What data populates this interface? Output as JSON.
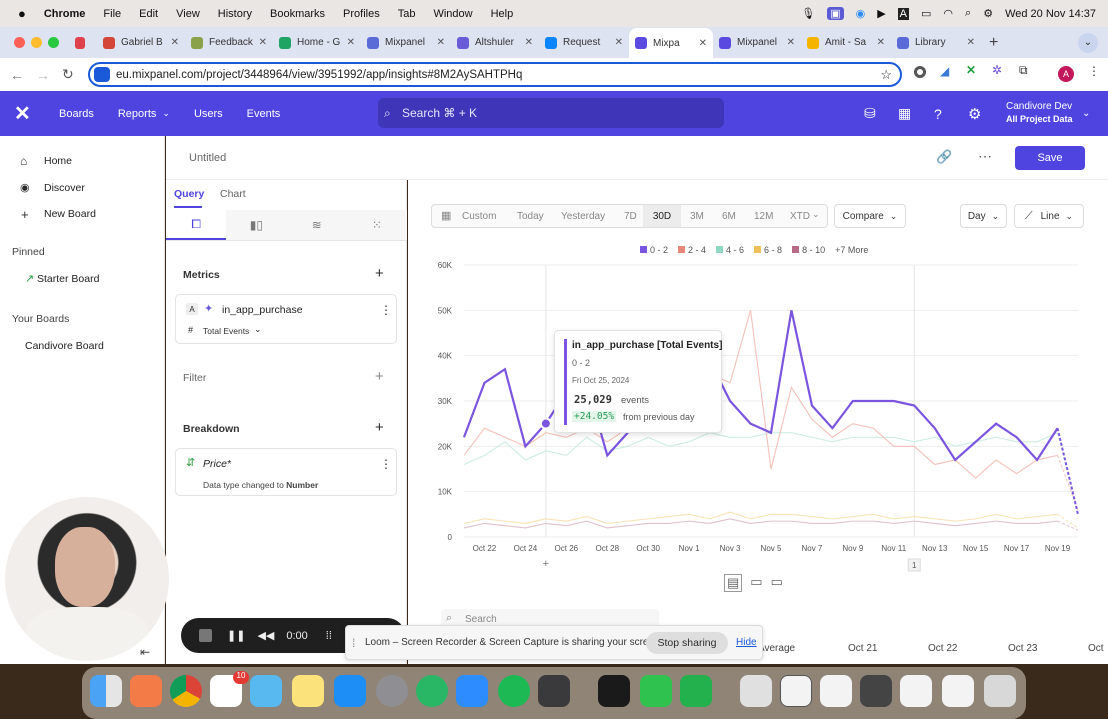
{
  "menubar": {
    "apple": "",
    "app": "Chrome",
    "menus": [
      "File",
      "Edit",
      "View",
      "History",
      "Bookmarks",
      "Profiles",
      "Tab",
      "Window",
      "Help"
    ],
    "datetime": "Wed 20 Nov  14:37"
  },
  "tabs": [
    {
      "label": "",
      "color": "#e0424b"
    },
    {
      "label": "Gabriel B",
      "color": "#d44638"
    },
    {
      "label": "Feedback",
      "color": "#8aa34a"
    },
    {
      "label": "Home - G",
      "color": "#1fa463"
    },
    {
      "label": "Mixpanel",
      "color": "#5a6bd8"
    },
    {
      "label": "Altshuler",
      "color": "#6a5cd6"
    },
    {
      "label": "Request",
      "color": "#0a84ff"
    },
    {
      "label": "Mixpa",
      "color": "#5a4ae0",
      "active": true
    },
    {
      "label": "Mixpanel",
      "color": "#5a4ae0"
    },
    {
      "label": "Amit - Sa",
      "color": "#f4b400"
    },
    {
      "label": "Library",
      "color": "#5a6bd8"
    }
  ],
  "address": {
    "url": "eu.mixpanel.com/project/3448964/view/3951992/app/insights#8M2AySAHTPHq"
  },
  "header": {
    "nav": [
      "Boards",
      "Reports",
      "Users",
      "Events"
    ],
    "search_placeholder": "Search  ⌘ + K",
    "org_name": "Candivore Dev",
    "org_sub": "All Project Data"
  },
  "sidebar": {
    "home": "Home",
    "discover": "Discover",
    "new_board": "New Board",
    "pinned": "Pinned",
    "starter_board": "Starter Board",
    "your_boards": "Your Boards",
    "candivore_board": "Candivore Board"
  },
  "report": {
    "title": "Untitled",
    "save": "Save"
  },
  "query": {
    "tab_query": "Query",
    "tab_chart": "Chart",
    "metrics": "Metrics",
    "metric_letter": "A",
    "metric_name": "in_app_purchase",
    "metric_measure": "Total Events",
    "filter": "Filter",
    "breakdown": "Breakdown",
    "breakdown_prop": "Price*",
    "breakdown_note_pre": "Data type changed to ",
    "breakdown_note_bold": "Number"
  },
  "toolbar": {
    "ranges": [
      "Custom",
      "Today",
      "Yesterday",
      "7D",
      "30D",
      "3M",
      "6M",
      "12M",
      "XTD"
    ],
    "active_range": "30D",
    "compare": "Compare",
    "granularity": "Day",
    "chart_type": "Line"
  },
  "legend": [
    {
      "label": "0 - 2",
      "color": "#7b55e0"
    },
    {
      "label": "2 - 4",
      "color": "#e8877a"
    },
    {
      "label": "4 - 6",
      "color": "#8fd9c4"
    },
    {
      "label": "6 - 8",
      "color": "#efbf5a"
    },
    {
      "label": "8 - 10",
      "color": "#b56a86"
    }
  ],
  "legend_more": "+7 More",
  "tooltip": {
    "title": "in_app_purchase [Total Events]",
    "series": "0 - 2",
    "date": "Fri Oct 25, 2024",
    "value": "25,029",
    "unit": "events",
    "change": "+24.05%",
    "change_label": "from previous day"
  },
  "chart_data": {
    "type": "line",
    "x": [
      "Oct 21",
      "Oct 22",
      "Oct 23",
      "Oct 24",
      "Oct 25",
      "Oct 26",
      "Oct 27",
      "Oct 28",
      "Oct 29",
      "Oct 30",
      "Oct 31",
      "Nov 1",
      "Nov 2",
      "Nov 3",
      "Nov 4",
      "Nov 5",
      "Nov 6",
      "Nov 7",
      "Nov 8",
      "Nov 9",
      "Nov 10",
      "Nov 11",
      "Nov 12",
      "Nov 13",
      "Nov 14",
      "Nov 15",
      "Nov 16",
      "Nov 17",
      "Nov 18",
      "Nov 19",
      "Nov 20"
    ],
    "x_ticks": [
      "Oct 22",
      "Oct 24",
      "Oct 26",
      "Oct 28",
      "Oct 30",
      "Nov 1",
      "Nov 3",
      "Nov 5",
      "Nov 7",
      "Nov 9",
      "Nov 11",
      "Nov 13",
      "Nov 15",
      "Nov 17",
      "Nov 19"
    ],
    "ylim": [
      0,
      60000
    ],
    "y_ticks": [
      0,
      10000,
      20000,
      30000,
      40000,
      50000,
      60000
    ],
    "y_tick_labels": [
      "0",
      "10K",
      "20K",
      "30K",
      "40K",
      "50K",
      "60K"
    ],
    "series": [
      {
        "name": "0 - 2",
        "color": "#7b55e0",
        "values": [
          22000,
          34000,
          37000,
          20000,
          25029,
          32000,
          34000,
          18000,
          23000,
          26000,
          36000,
          31000,
          39000,
          30000,
          25000,
          23000,
          50000,
          29000,
          24000,
          30000,
          30000,
          30000,
          29000,
          24000,
          17000,
          21000,
          25000,
          22000,
          17000,
          24000,
          5000
        ]
      },
      {
        "name": "2 - 4",
        "color": "#f2b2a8",
        "values": [
          18000,
          24000,
          22000,
          20000,
          23000,
          22000,
          24000,
          21000,
          24000,
          27000,
          30000,
          32000,
          36000,
          34000,
          50000,
          15000,
          33000,
          26000,
          22000,
          25000,
          24000,
          20000,
          20000,
          16000,
          17000,
          13000,
          17000,
          14000,
          17000,
          18000,
          6000
        ]
      },
      {
        "name": "4 - 6",
        "color": "#bfe8dc",
        "values": [
          16000,
          18000,
          21000,
          17000,
          19000,
          18000,
          22000,
          19000,
          20000,
          22000,
          20000,
          21000,
          23000,
          22000,
          22000,
          23000,
          23000,
          22000,
          21000,
          22000,
          22000,
          22000,
          21000,
          22000,
          20000,
          21000,
          22000,
          21000,
          21000,
          23000,
          5000
        ]
      },
      {
        "name": "6 - 8",
        "color": "#f5dca2",
        "values": [
          3000,
          4000,
          3500,
          3000,
          4000,
          3500,
          4500,
          3000,
          3500,
          4000,
          4500,
          5000,
          4000,
          5500,
          4000,
          5000,
          5000,
          4500,
          4000,
          4500,
          5000,
          4000,
          4500,
          4000,
          3500,
          4000,
          5000,
          4000,
          4500,
          5000,
          2000
        ]
      },
      {
        "name": "8 - 10",
        "color": "#d8b0c0",
        "values": [
          2000,
          3000,
          2500,
          2000,
          3000,
          2500,
          3500,
          2000,
          2500,
          3000,
          3000,
          3500,
          3000,
          4000,
          3000,
          3500,
          3500,
          3000,
          3000,
          3500,
          3500,
          3000,
          3500,
          3000,
          2500,
          3000,
          3500,
          3000,
          3000,
          3500,
          1500
        ]
      }
    ],
    "marker_text": [
      "1"
    ]
  },
  "bottom": {
    "search_placeholder": "Search",
    "average": "Average",
    "dates": [
      "Oct 21",
      "Oct 22",
      "Oct 23",
      "Oct"
    ]
  },
  "loom": {
    "message": "Loom – Screen Recorder & Screen Capture is sharing your screen.",
    "stop": "Stop sharing",
    "hide": "Hide",
    "time": "0:00"
  }
}
